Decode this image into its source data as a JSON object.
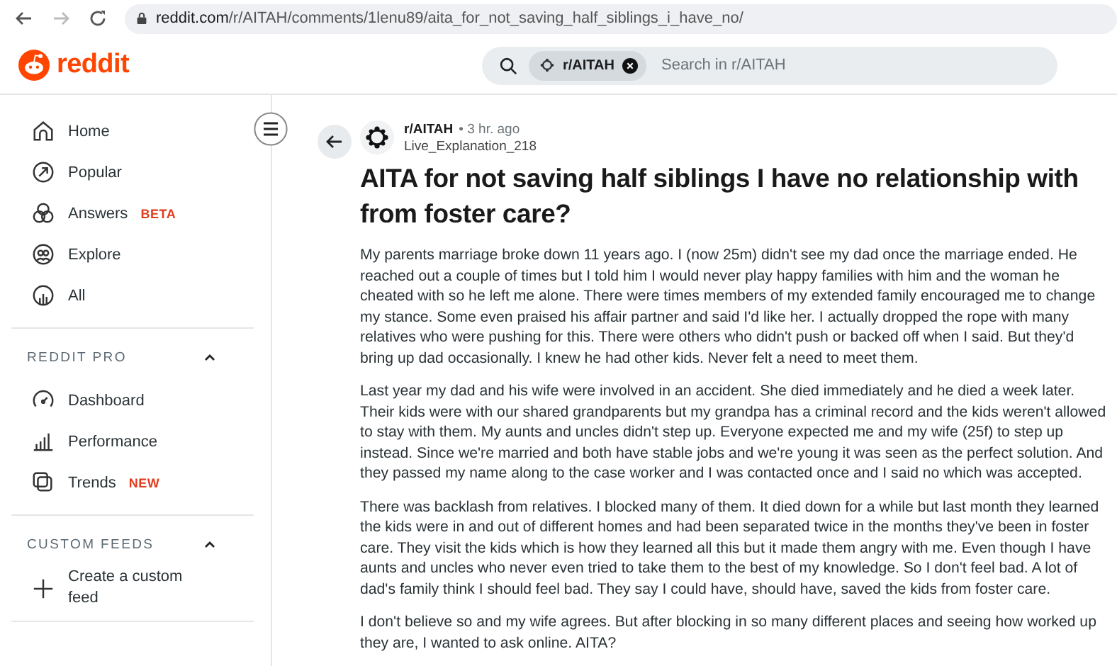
{
  "browser": {
    "url_host": "reddit.com",
    "url_path": "/r/AITAH/comments/1lenu89/aita_for_not_saving_half_siblings_i_have_no/"
  },
  "header": {
    "logo": "reddit",
    "search": {
      "chip": "r/AITAH",
      "placeholder": "Search in r/AITAH"
    }
  },
  "sidebar": {
    "items": [
      {
        "label": "Home"
      },
      {
        "label": "Popular"
      },
      {
        "label": "Answers",
        "badge": "BETA"
      },
      {
        "label": "Explore"
      },
      {
        "label": "All"
      }
    ],
    "sections": [
      {
        "title": "REDDIT PRO",
        "expanded": true,
        "items": [
          {
            "label": "Dashboard"
          },
          {
            "label": "Performance"
          },
          {
            "label": "Trends",
            "badge": "NEW"
          }
        ]
      },
      {
        "title": "CUSTOM FEEDS",
        "expanded": true,
        "items": [
          {
            "label": "Create a custom feed"
          }
        ]
      }
    ]
  },
  "post": {
    "subreddit": "r/AITAH",
    "time": "• 3 hr. ago",
    "author": "Live_Explanation_218",
    "title": "AITA for not saving half siblings I have no relationship with from foster care?",
    "paragraphs": [
      "My parents marriage broke down 11 years ago. I (now 25m) didn't see my dad once the marriage ended. He reached out a couple of times but I told him I would never play happy families with him and the woman he cheated with so he left me alone. There were times members of my extended family encouraged me to change my stance. Some even praised his affair partner and said I'd like her. I actually dropped the rope with many relatives who were pushing for this. There were others who didn't push or backed off when I said. But they'd bring up dad occasionally. I knew he had other kids. Never felt a need to meet them.",
      "Last year my dad and his wife were involved in an accident. She died immediately and he died a week later. Their kids were with our shared grandparents but my grandpa has a criminal record and the kids weren't allowed to stay with them. My aunts and uncles didn't step up. Everyone expected me and my wife (25f) to step up instead. Since we're married and both have stable jobs and we're young it was seen as the perfect solution. And they passed my name along to the case worker and I was contacted once and I said no which was accepted.",
      "There was backlash from relatives. I blocked many of them. It died down for a while but last month they learned the kids were in and out of different homes and had been separated twice in the months they've been in foster care. They visit the kids which is how they learned all this but it made them angry with me. Even though I have aunts and uncles who never even tried to take them to the best of my knowledge. So I don't feel bad. A lot of dad's family think I should feel bad. They say I could have, should have, saved the kids from foster care.",
      "I don't believe so and my wife agrees. But after blocking in so many different places and seeing how worked up they are, I wanted to ask online. AITA?"
    ]
  }
}
